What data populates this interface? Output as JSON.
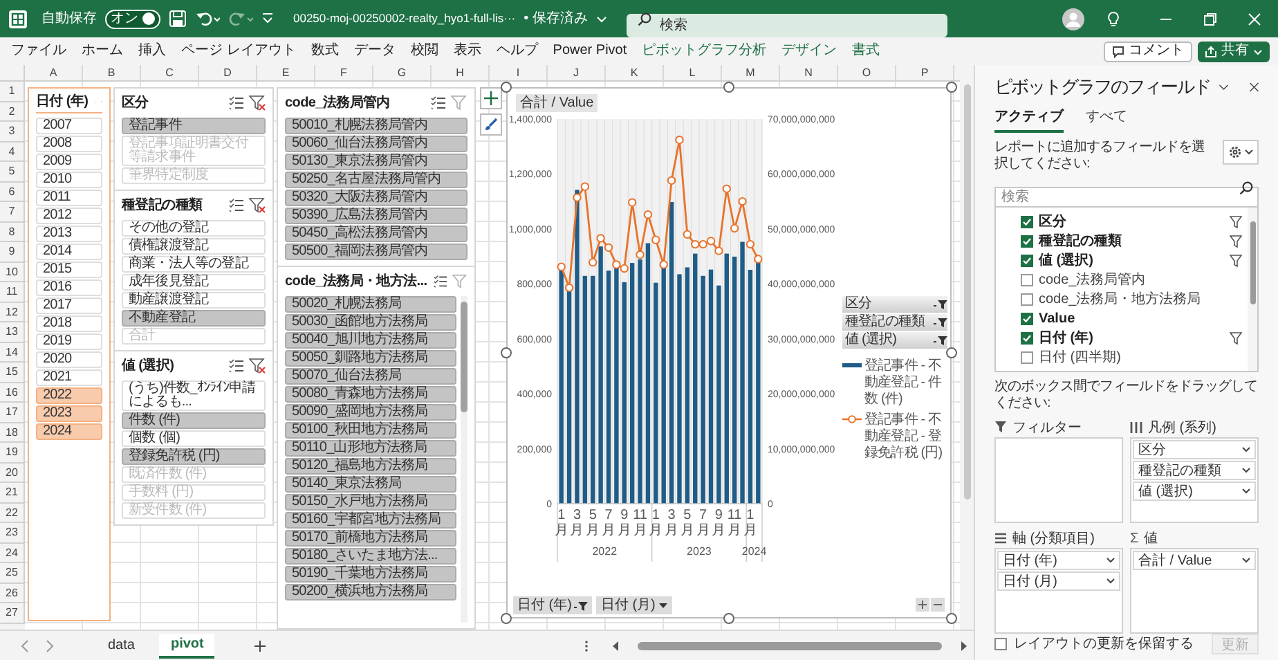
{
  "title_bar": {
    "autosave_label": "自動保存",
    "autosave_toggle": {
      "label": "オン",
      "on": true
    },
    "file_name": "00250-moj-00250002-realty_hyo1-full-lis···",
    "save_status": "• 保存済み",
    "search_placeholder": "検索"
  },
  "ribbon_tabs": [
    {
      "label": "ファイル",
      "contextual": false
    },
    {
      "label": "ホーム",
      "contextual": false
    },
    {
      "label": "挿入",
      "contextual": false
    },
    {
      "label": "ページ レイアウト",
      "contextual": false
    },
    {
      "label": "数式",
      "contextual": false
    },
    {
      "label": "データ",
      "contextual": false
    },
    {
      "label": "校閲",
      "contextual": false
    },
    {
      "label": "表示",
      "contextual": false
    },
    {
      "label": "ヘルプ",
      "contextual": false
    },
    {
      "label": "Power Pivot",
      "contextual": false
    },
    {
      "label": "ピボットグラフ分析",
      "contextual": true
    },
    {
      "label": "デザイン",
      "contextual": true
    },
    {
      "label": "書式",
      "contextual": true
    }
  ],
  "ribbon_buttons": [
    {
      "label": "コメント",
      "kind": "outline"
    },
    {
      "label": "共有",
      "kind": "primary"
    }
  ],
  "sheet": {
    "columns": [
      "A",
      "B",
      "C",
      "D",
      "E",
      "F",
      "G",
      "H",
      "I",
      "J",
      "K",
      "L",
      "M",
      "N",
      "O",
      "P"
    ],
    "rows": [
      "1",
      "2",
      "3",
      "4",
      "5",
      "6",
      "7",
      "8",
      "9",
      "10",
      "11",
      "12",
      "13",
      "14",
      "15",
      "16",
      "17",
      "18",
      "19",
      "20",
      "21",
      "22",
      "23",
      "24",
      "25",
      "26",
      "27"
    ]
  },
  "slicers": [
    {
      "title": "日付 (年)",
      "filter_active": true,
      "items": [
        {
          "label": "2007",
          "selected": false,
          "disabled": false
        },
        {
          "label": "2008",
          "selected": false,
          "disabled": false
        },
        {
          "label": "2009",
          "selected": false,
          "disabled": false
        },
        {
          "label": "2010",
          "selected": false,
          "disabled": false
        },
        {
          "label": "2011",
          "selected": false,
          "disabled": false
        },
        {
          "label": "2012",
          "selected": false,
          "disabled": false
        },
        {
          "label": "2013",
          "selected": false,
          "disabled": false
        },
        {
          "label": "2014",
          "selected": false,
          "disabled": false
        },
        {
          "label": "2015",
          "selected": false,
          "disabled": false
        },
        {
          "label": "2016",
          "selected": false,
          "disabled": false
        },
        {
          "label": "2017",
          "selected": false,
          "disabled": false
        },
        {
          "label": "2018",
          "selected": false,
          "disabled": false
        },
        {
          "label": "2019",
          "selected": false,
          "disabled": false
        },
        {
          "label": "2020",
          "selected": false,
          "disabled": false
        },
        {
          "label": "2021",
          "selected": false,
          "disabled": false
        },
        {
          "label": "2022",
          "selected": true,
          "disabled": false
        },
        {
          "label": "2023",
          "selected": true,
          "disabled": false
        },
        {
          "label": "2024",
          "selected": true,
          "disabled": false
        }
      ]
    },
    {
      "title": "区分",
      "filter_active": true,
      "items": [
        {
          "label": "登記事件",
          "selected": true,
          "disabled": false
        },
        {
          "label": "登記事項証明書交付等請求事件",
          "selected": false,
          "disabled": true
        },
        {
          "label": "筆界特定制度",
          "selected": false,
          "disabled": true
        }
      ]
    },
    {
      "title": "種登記の種類",
      "filter_active": true,
      "items": [
        {
          "label": "その他の登記",
          "selected": false,
          "disabled": false
        },
        {
          "label": "債権譲渡登記",
          "selected": false,
          "disabled": false
        },
        {
          "label": "商業・法人等の登記",
          "selected": false,
          "disabled": false
        },
        {
          "label": "成年後見登記",
          "selected": false,
          "disabled": false
        },
        {
          "label": "動産譲渡登記",
          "selected": false,
          "disabled": false
        },
        {
          "label": "不動産登記",
          "selected": true,
          "disabled": false
        },
        {
          "label": "合計",
          "selected": false,
          "disabled": true
        }
      ]
    },
    {
      "title": "値 (選択)",
      "filter_active": true,
      "items": [
        {
          "label": "(うち)件数_ｵﾝﾗｲﾝ申請によるも...",
          "selected": false,
          "disabled": false
        },
        {
          "label": "件数 (件)",
          "selected": true,
          "disabled": false
        },
        {
          "label": "個数 (個)",
          "selected": false,
          "disabled": false
        },
        {
          "label": "登録免許税 (円)",
          "selected": true,
          "disabled": false
        },
        {
          "label": "既済件数 (件)",
          "selected": false,
          "disabled": true
        },
        {
          "label": "手数料 (円)",
          "selected": false,
          "disabled": true
        },
        {
          "label": "新受件数 (件)",
          "selected": false,
          "disabled": true
        }
      ]
    },
    {
      "title": "code_法務局管内",
      "filter_active": false,
      "items": [
        {
          "label": "50010_札幌法務局管内",
          "selected": true,
          "disabled": false
        },
        {
          "label": "50060_仙台法務局管内",
          "selected": true,
          "disabled": false
        },
        {
          "label": "50130_東京法務局管内",
          "selected": true,
          "disabled": false
        },
        {
          "label": "50250_名古屋法務局管内",
          "selected": true,
          "disabled": false
        },
        {
          "label": "50320_大阪法務局管内",
          "selected": true,
          "disabled": false
        },
        {
          "label": "50390_広島法務局管内",
          "selected": true,
          "disabled": false
        },
        {
          "label": "50450_高松法務局管内",
          "selected": true,
          "disabled": false
        },
        {
          "label": "50500_福岡法務局管内",
          "selected": true,
          "disabled": false
        }
      ]
    },
    {
      "title": "code_法務局・地方法...",
      "filter_active": false,
      "scrollable": true,
      "items": [
        {
          "label": "50020_札幌法務局",
          "selected": true,
          "disabled": false
        },
        {
          "label": "50030_函館地方法務局",
          "selected": true,
          "disabled": false
        },
        {
          "label": "50040_旭川地方法務局",
          "selected": true,
          "disabled": false
        },
        {
          "label": "50050_釧路地方法務局",
          "selected": true,
          "disabled": false
        },
        {
          "label": "50070_仙台法務局",
          "selected": true,
          "disabled": false
        },
        {
          "label": "50080_青森地方法務局",
          "selected": true,
          "disabled": false
        },
        {
          "label": "50090_盛岡地方法務局",
          "selected": true,
          "disabled": false
        },
        {
          "label": "50100_秋田地方法務局",
          "selected": true,
          "disabled": false
        },
        {
          "label": "50110_山形地方法務局",
          "selected": true,
          "disabled": false
        },
        {
          "label": "50120_福島地方法務局",
          "selected": true,
          "disabled": false
        },
        {
          "label": "50140_東京法務局",
          "selected": true,
          "disabled": false
        },
        {
          "label": "50150_水戸地方法務局",
          "selected": true,
          "disabled": false
        },
        {
          "label": "50160_宇都宮地方法務局",
          "selected": true,
          "disabled": false
        },
        {
          "label": "50170_前橋地方法務局",
          "selected": true,
          "disabled": false
        },
        {
          "label": "50180_さいたま地方法...",
          "selected": true,
          "disabled": false
        },
        {
          "label": "50190_千葉地方法務局",
          "selected": true,
          "disabled": false
        },
        {
          "label": "50200_横浜地方法務局",
          "selected": true,
          "disabled": false
        }
      ]
    }
  ],
  "chart": {
    "field_button": "合計 / Value",
    "chart_data": {
      "type": "bar",
      "ylim": [
        0,
        1400000
      ],
      "yticks": [
        {
          "value": 0,
          "label": "0"
        },
        {
          "value": 200000,
          "label": "200,000"
        },
        {
          "value": 400000,
          "label": "400,000"
        },
        {
          "value": 600000,
          "label": "600,000"
        },
        {
          "value": 800000,
          "label": "800,000"
        },
        {
          "value": 1000000,
          "label": "1,000,000"
        },
        {
          "value": 1200000,
          "label": "1,200,000"
        },
        {
          "value": 1400000,
          "label": "1,400,000"
        }
      ],
      "y2lim": [
        0,
        70000000000
      ],
      "y2ticks": [
        {
          "value": 0,
          "label": "0"
        },
        {
          "value": 10000000000,
          "label": "10,000,000,000"
        },
        {
          "value": 20000000000,
          "label": "20,000,000,000"
        },
        {
          "value": 30000000000,
          "label": "30,000,000,000"
        },
        {
          "value": 40000000000,
          "label": "40,000,000,000"
        },
        {
          "value": 50000000000,
          "label": "50,000,000,000"
        },
        {
          "value": 60000000000,
          "label": "60,000,000,000"
        },
        {
          "value": 70000000000,
          "label": "70,000,000,000"
        }
      ],
      "categories": [
        "1月",
        null,
        "3月",
        null,
        "5月",
        null,
        "7月",
        null,
        "9月",
        null,
        "11月",
        null,
        "1月",
        null,
        "3月",
        null,
        "5月",
        null,
        "7月",
        null,
        "9月",
        null,
        "11月",
        null,
        "1月",
        null
      ],
      "legend": "right",
      "series": [
        {
          "name": "登記事件 - 不動産登記 - 件数 (件)",
          "color": "#1f5c87",
          "type": "bar",
          "values": [
            855000,
            786000,
            1142000,
            829000,
            829000,
            936000,
            848000,
            863000,
            806000,
            876000,
            889000,
            948000,
            804000,
            863000,
            1098000,
            835000,
            860000,
            910000,
            829000,
            852000,
            794000,
            910000,
            899000,
            953000,
            851000,
            882000
          ]
        },
        {
          "name": "登記事件 - 不動産登記 - 登録免許税 (円)",
          "color": "#e8732a",
          "type": "line",
          "axis": "y2",
          "marker": "circle",
          "values": [
            43100000000,
            39300000000,
            55700000000,
            57700000000,
            43900000000,
            48300000000,
            46600000000,
            43500000000,
            42800000000,
            54800000000,
            45300000000,
            52600000000,
            48000000000,
            43500000000,
            58800000000,
            66200000000,
            49000000000,
            47200000000,
            47200000000,
            47800000000,
            46000000000,
            57300000000,
            50100000000,
            55000000000,
            47200000000,
            44500000000
          ]
        }
      ]
    },
    "year_labels": [
      "2022",
      "2023",
      "2024"
    ],
    "legend_filters": [
      "区分",
      "種登記の種類",
      "値 (選択)"
    ],
    "axis_buttons": [
      {
        "label": "日付 (年)",
        "filtered": true
      },
      {
        "label": "日付 (月)",
        "filtered": false
      }
    ]
  },
  "field_pane": {
    "title": "ピボットグラフのフィールド",
    "tabs": [
      {
        "label": "アクティブ",
        "selected": true
      },
      {
        "label": "すべて",
        "selected": false
      }
    ],
    "instruction": "レポートに追加するフィールドを選択してください:",
    "search_placeholder": "検索",
    "fields": [
      {
        "label": "区分",
        "checked": true,
        "filtered": true
      },
      {
        "label": "種登記の種類",
        "checked": true,
        "filtered": true
      },
      {
        "label": "値 (選択)",
        "checked": true,
        "filtered": true
      },
      {
        "label": "code_法務局管内",
        "checked": false,
        "filtered": false
      },
      {
        "label": "code_法務局・地方法務局",
        "checked": false,
        "filtered": false
      },
      {
        "label": "Value",
        "checked": true,
        "filtered": false
      },
      {
        "label": "日付 (年)",
        "checked": true,
        "filtered": true
      },
      {
        "label": "日付 (四半期)",
        "checked": false,
        "filtered": false
      }
    ],
    "drag_instruction": "次のボックス間でフィールドをドラッグしてください:",
    "areas": [
      {
        "kind": "filter",
        "title": "フィルター"
      },
      {
        "kind": "legend",
        "title": "凡例 (系列)",
        "items": [
          "区分",
          "種登記の種類",
          "値 (選択)"
        ]
      },
      {
        "kind": "axis",
        "title": "軸 (分類項目)",
        "items": [
          "日付 (年)",
          "日付 (月)"
        ]
      },
      {
        "kind": "values",
        "symbol": "Σ",
        "title": "値",
        "items": [
          "合計 / Value"
        ]
      }
    ],
    "defer_update": {
      "label": "レイアウトの更新を保留する",
      "checked": false
    },
    "update_button": {
      "label": "更新",
      "disabled": true
    }
  },
  "sheet_tabs": [
    {
      "label": "data",
      "selected": false
    },
    {
      "label": "pivot",
      "selected": true
    }
  ]
}
